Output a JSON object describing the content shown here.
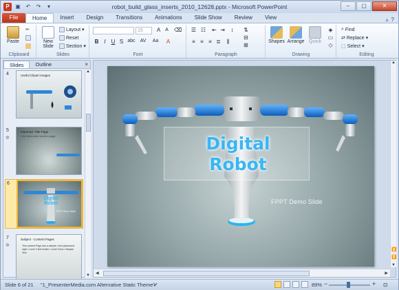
{
  "window": {
    "title": "robot_build_glass_inserts_2010_12628.pptx - Microsoft PowerPoint",
    "min_icon": "minimize-icon",
    "max_icon": "maximize-icon",
    "close_icon": "close-icon"
  },
  "tabs": {
    "file": "File",
    "items": [
      "Home",
      "Insert",
      "Design",
      "Transitions",
      "Animations",
      "Slide Show",
      "Review",
      "View"
    ],
    "active": "Home"
  },
  "ribbon": {
    "clipboard": {
      "label": "Clipboard",
      "paste": "Paste"
    },
    "slides": {
      "label": "Slides",
      "new_slide": "New Slide",
      "new_slide_2": "Slide",
      "layout": "Layout",
      "reset": "Reset",
      "section": "Section"
    },
    "font": {
      "label": "Font",
      "size": "15",
      "bold": "B",
      "italic": "I",
      "underline": "U",
      "strike": "S",
      "shadow": "abc",
      "spacing": "AV",
      "case": "Aa",
      "color": "A",
      "grow": "A",
      "shrink": "A"
    },
    "paragraph": {
      "label": "Paragraph"
    },
    "drawing": {
      "label": "Drawing",
      "shapes": "Shapes",
      "arrange": "Arrange",
      "quick_styles": "Quick",
      "quick_styles_2": "Styles"
    },
    "editing": {
      "label": "Editing",
      "find": "Find",
      "replace": "Replace",
      "select": "Select"
    }
  },
  "panel": {
    "tabs": [
      "Slides",
      "Outline"
    ],
    "close": "×",
    "thumbnails": [
      {
        "num": "4",
        "title": "Useful Clipart Images",
        "sub": "",
        "body": ""
      },
      {
        "num": "5",
        "title": "Intermed. Title Page",
        "sub": "Like alternative section page",
        "body": ""
      },
      {
        "num": "6",
        "title": "Digital",
        "sub": "Robot",
        "body": "FPPT Demo Slide"
      },
      {
        "num": "7",
        "title": "Subject - Content Pages",
        "sub": "",
        "body": "This content Page has a sample • text placement style • Level 2 text holder • Level 3 text • Sample Text"
      }
    ]
  },
  "slide": {
    "title_line1": "Digital",
    "title_line2": "Robot",
    "subtitle": "FPPT Demo Slide"
  },
  "status": {
    "slide_info": "Slide 6 of 21",
    "theme": "\"1_PresenterMedia.com Alternative Static Theme\"",
    "zoom": "89%",
    "minus": "−",
    "plus": "+"
  },
  "colors": {
    "accent": "#3ab6f1",
    "file_tab": "#c43b1d",
    "robot_blue": "#1f78d1"
  }
}
